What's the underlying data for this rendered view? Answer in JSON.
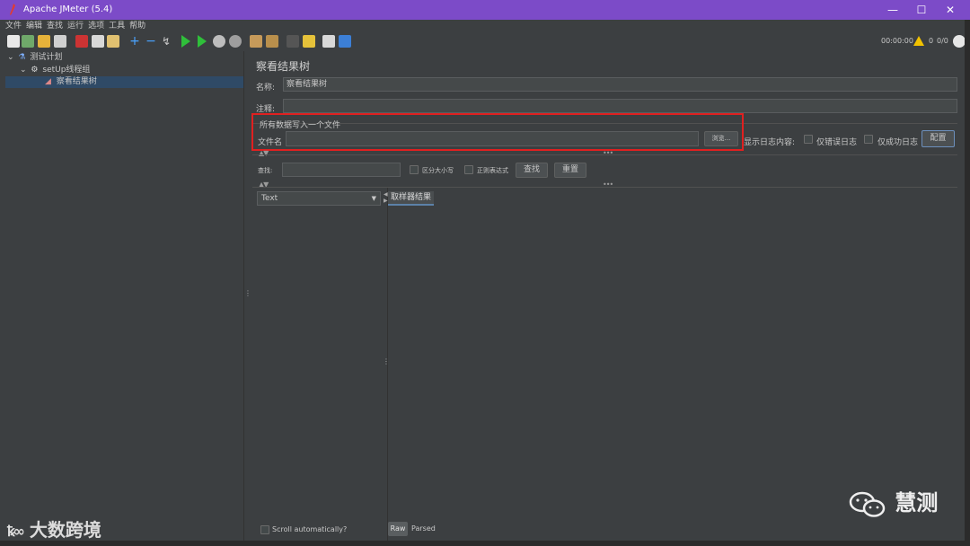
{
  "window": {
    "title": "Apache JMeter (5.4)",
    "minimize": "—",
    "maximize": "☐",
    "close": "✕"
  },
  "menu": [
    "文件",
    "编辑",
    "查找",
    "运行",
    "选项",
    "工具",
    "帮助"
  ],
  "toolbar": {
    "timer": "00:00:00",
    "warn_count": "0",
    "thread_count": "0/0"
  },
  "tree": {
    "root": "测试计划",
    "group": "setUp线程组",
    "listener": "察看结果树"
  },
  "panel": {
    "title": "察看结果树",
    "name_label": "名称:",
    "name_value": "察看结果树",
    "comment_label": "注释:",
    "comment_value": "",
    "file_group_title": "所有数据写入一个文件",
    "filename_label": "文件名",
    "filename_value": "",
    "browse_button": "浏览...",
    "log_display_label": "显示日志内容:",
    "errors_only_label": "仅错误日志",
    "success_only_label": "仅成功日志",
    "configure_button": "配置",
    "search_label": "查找:",
    "search_value": "",
    "case_sensitive_label": "区分大小写",
    "regex_label": "正则表达式",
    "find_button": "查找",
    "reset_button": "重置",
    "renderer_selected": "Text",
    "sampler_result_tab": "取样器结果",
    "scroll_auto_label": "Scroll automatically?",
    "raw_tab": "Raw",
    "parsed_tab": "Parsed"
  },
  "watermarks": {
    "left": "大数跨境",
    "right": "慧测"
  },
  "colors": {
    "titlebar": "#7c4bc8",
    "background": "#3c3f41",
    "highlight": "#e02020",
    "selection": "#2f4a66"
  }
}
